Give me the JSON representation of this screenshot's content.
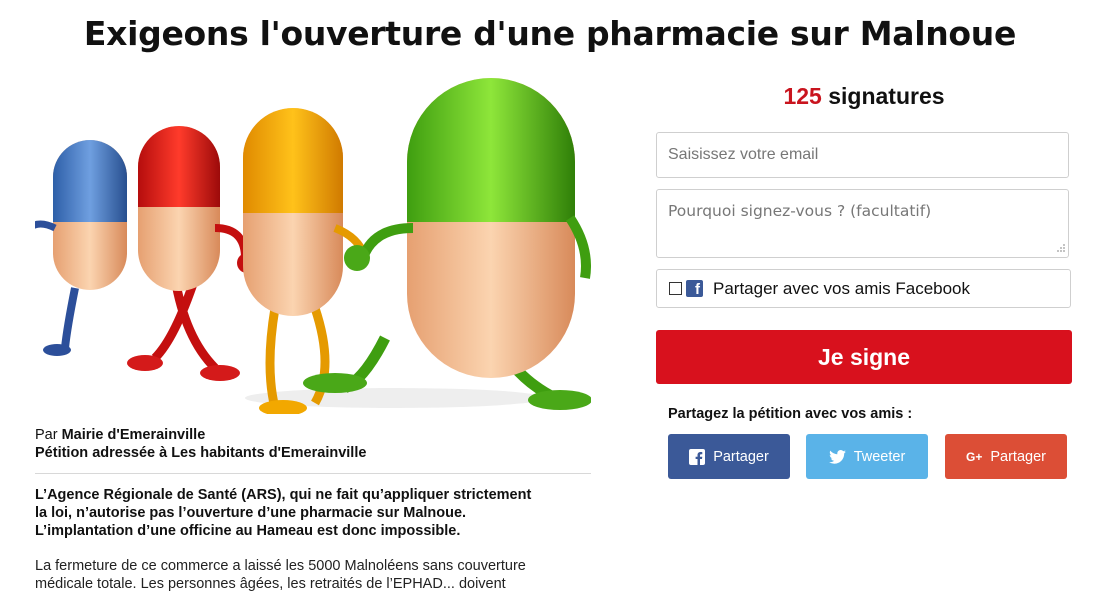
{
  "page": {
    "title": "Exigeons l'ouverture d'une pharmacie sur Malnoue"
  },
  "author": {
    "prefix": "Par ",
    "name": "Mairie d'Emerainville",
    "addressed_to": "Pétition adressée à Les habitants d'Emerainville"
  },
  "content": {
    "intro_line1": "L’Agence Régionale de Santé (ARS), qui ne fait qu’appliquer strictement",
    "intro_line2": "la loi, n’autorise pas l’ouverture d’une pharmacie sur Malnoue.",
    "intro_line3": "L’implantation d’une officine au Hameau est donc impossible.",
    "body_line1": "La fermeture de ce commerce a laissé les 5000 Malnoléens sans couverture",
    "body_line2": "médicale totale. Les personnes âgées, les retraités de l’EPHAD... doivent"
  },
  "signatures": {
    "count": "125",
    "label": " signatures"
  },
  "form": {
    "email_placeholder": "Saisissez votre email",
    "reason_placeholder": "Pourquoi signez-vous ? (facultatif)",
    "facebook_share_label": "Partager avec vos amis Facebook",
    "facebook_share_checked": false,
    "submit_label": "Je signe"
  },
  "share": {
    "heading": "Partagez la pétition avec vos amis :",
    "facebook_label": "Partager",
    "twitter_label": "Tweeter",
    "google_label": "Partager",
    "google_icon_text": "G+"
  },
  "colors": {
    "accent_red": "#d8111d",
    "facebook": "#3b5998",
    "twitter": "#5ab3e8",
    "google": "#dc4e36"
  },
  "icons": [
    "checkbox-icon",
    "facebook-icon",
    "twitter-icon",
    "google-plus-icon",
    "resize-grip-icon"
  ]
}
